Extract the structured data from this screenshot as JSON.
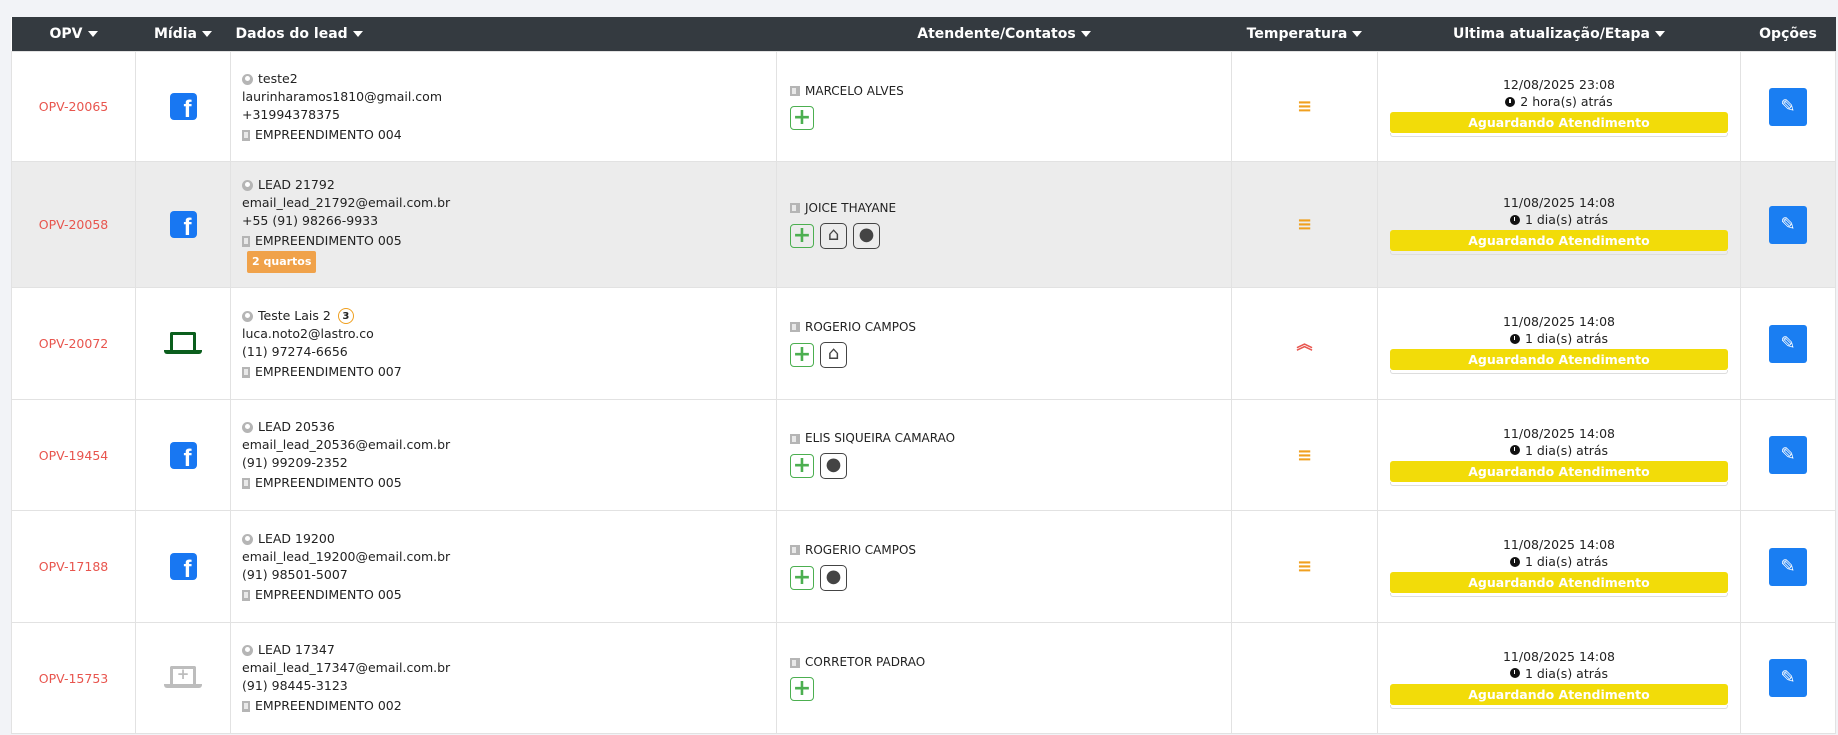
{
  "header": {
    "opv": "OPV",
    "midia": "Mídia",
    "dados": "Dados do lead",
    "atendente": "Atendente/Contatos",
    "temperatura": "Temperatura",
    "ultima": "Ultima atualização/Etapa",
    "opcoes": "Opções"
  },
  "rows": [
    {
      "opv": "OPV-20065",
      "media": "facebook-icon",
      "name": "teste2",
      "email": "laurinharamos1810@gmail.com",
      "phone": "+31994378375",
      "empreendimento": "EMPREENDIMENTO 004",
      "atendente": "MARCELO ALVES",
      "temperatura": "≡",
      "date": "12/08/2025 23:08",
      "ago": "2 hora(s) atrás",
      "etapa": "Aguardando Atendimento"
    },
    {
      "opv": "OPV-20058",
      "media": "facebook-icon",
      "name": "LEAD 21792",
      "email": "email_lead_21792@email.com.br",
      "phone": "+55 (91) 98266-9933",
      "empreendimento": "EMPREENDIMENTO 005",
      "tag": "2 quartos",
      "atendente": "JOICE THAYANE",
      "temperatura": "≡",
      "date": "11/08/2025 14:08",
      "ago": "1 dia(s) atrás",
      "etapa": "Aguardando Atendimento"
    },
    {
      "opv": "OPV-20072",
      "media": "laptop-icon",
      "name": "Teste Lais 2",
      "count": "3",
      "email": "luca.noto2@lastro.co",
      "phone": "(11) 97274-6656",
      "empreendimento": "EMPREENDIMENTO 007",
      "atendente": "ROGERIO CAMPOS",
      "temperatura": "︽",
      "date": "11/08/2025 14:08",
      "ago": "1 dia(s) atrás",
      "etapa": "Aguardando Atendimento"
    },
    {
      "opv": "OPV-19454",
      "media": "facebook-icon",
      "name": "LEAD 20536",
      "email": "email_lead_20536@email.com.br",
      "phone": "(91) 99209-2352",
      "empreendimento": "EMPREENDIMENTO 005",
      "atendente": "ELIS SIQUEIRA CAMARAO",
      "temperatura": "≡",
      "date": "11/08/2025 14:08",
      "ago": "1 dia(s) atrás",
      "etapa": "Aguardando Atendimento"
    },
    {
      "opv": "OPV-17188",
      "media": "facebook-icon",
      "name": "LEAD 19200",
      "email": "email_lead_19200@email.com.br",
      "phone": "(91) 98501-5007",
      "empreendimento": "EMPREENDIMENTO 005",
      "atendente": "ROGERIO CAMPOS",
      "temperatura": "≡",
      "date": "11/08/2025 14:08",
      "ago": "1 dia(s) atrás",
      "etapa": "Aguardando Atendimento"
    },
    {
      "opv": "OPV-15753",
      "media": "laptop-plus-icon",
      "name": "LEAD 17347",
      "email": "email_lead_17347@email.com.br",
      "phone": "(91) 98445-3123",
      "empreendimento": "EMPREENDIMENTO 002",
      "atendente": "CORRETOR PADRAO",
      "date": "11/08/2025 14:08",
      "ago": "1 dia(s) atrás",
      "etapa": "Aguardando Atendimento"
    }
  ],
  "colors": {
    "header_bg": "#343a40",
    "opv_red": "#e8554e",
    "stage_yellow": "#f2dc09",
    "edit_blue": "#1a7ef2",
    "add_green": "#4caf50"
  }
}
